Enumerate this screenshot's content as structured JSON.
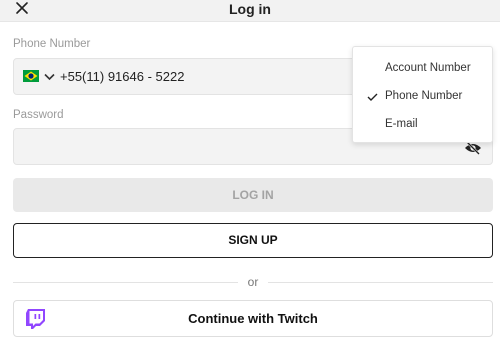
{
  "header": {
    "title": "Log in",
    "close_icon": "close-icon"
  },
  "phone": {
    "label": "Phone Number",
    "country_flag": "brazil-flag-icon",
    "value": "+55(11) 91646 - 5222"
  },
  "password": {
    "label": "Password",
    "value": "",
    "visibility_icon": "eye-slash-icon"
  },
  "login_type_menu": {
    "items": [
      {
        "label": "Account Number",
        "selected": false
      },
      {
        "label": "Phone Number",
        "selected": true
      },
      {
        "label": "E-mail",
        "selected": false
      }
    ]
  },
  "actions": {
    "login_label": "LOG IN",
    "signup_label": "SIGN UP",
    "separator": "or",
    "twitch_label": "Continue with Twitch"
  },
  "colors": {
    "twitch_purple": "#9146ff",
    "flag_green": "#009c3b",
    "flag_yellow": "#ffdf00",
    "flag_blue": "#002776"
  }
}
